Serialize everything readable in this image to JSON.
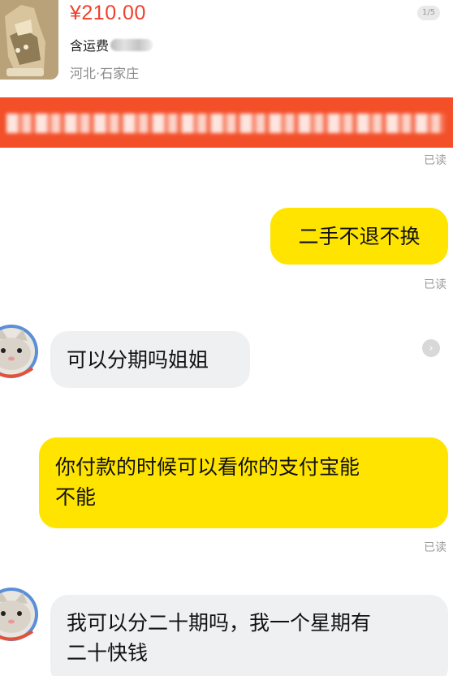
{
  "product": {
    "price": "¥210.00",
    "shipping_label": "含运费",
    "location": "河北·石家庄",
    "page_indicator": "1/5"
  },
  "notice": {
    "text": ""
  },
  "messages": [
    {
      "side": "sent",
      "text": "二手不退不换",
      "read": "已读"
    },
    {
      "side": "received",
      "text": "可以分期吗姐姐"
    },
    {
      "side": "sent",
      "text_line1": "你付款的时候可以看你的支付宝能",
      "text_line2": "不能",
      "read": "已读"
    },
    {
      "side": "received",
      "text_line1": "我可以分二十期吗，我一个星期有",
      "text_line2": "二十快钱"
    }
  ],
  "read_receipt_top": "已读",
  "icons": {
    "more": "chevron-right-icon",
    "avatar": "cat-avatar-icon",
    "product_image": "sneaker-image"
  },
  "colors": {
    "price": "#f0402c",
    "banner": "#f3502a",
    "sent_bubble": "#ffe400",
    "received_bubble": "#eef0f2"
  }
}
